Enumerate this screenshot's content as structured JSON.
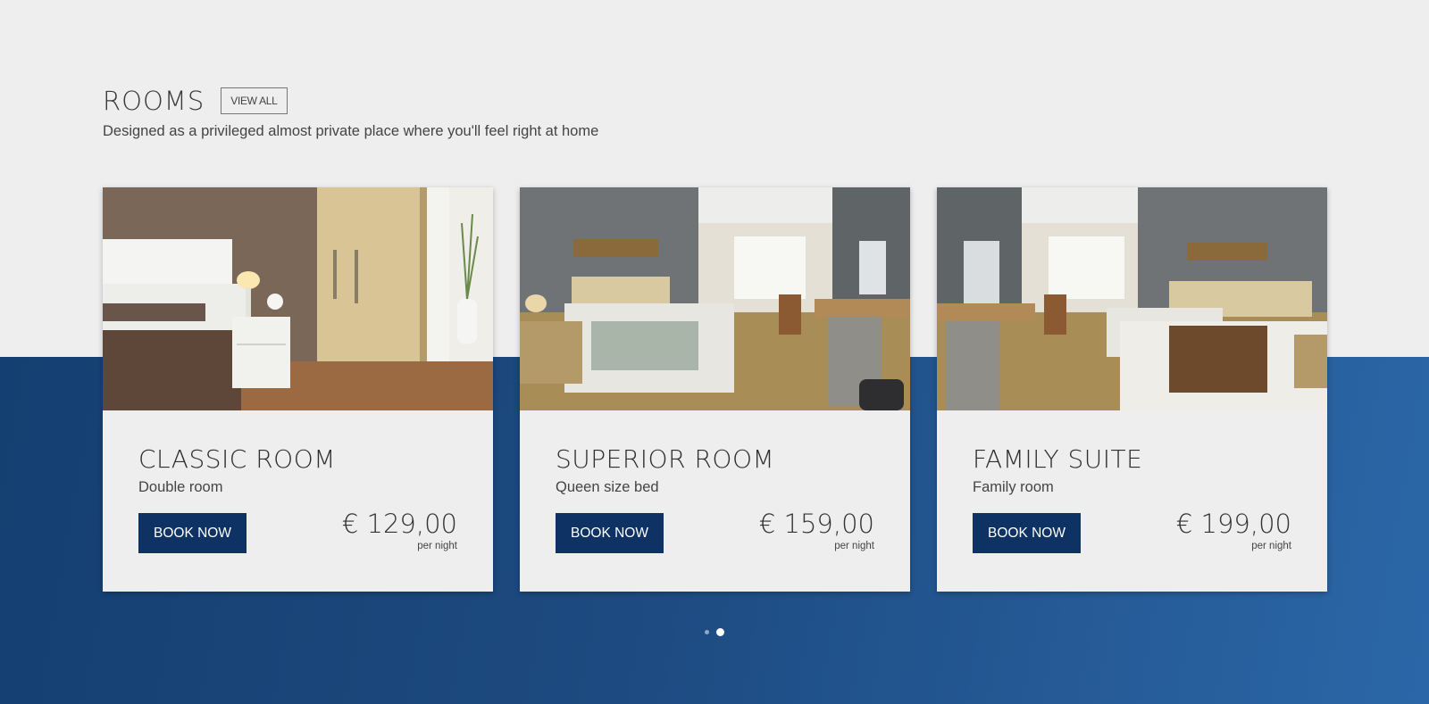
{
  "section": {
    "title": "ROOMS",
    "view_all_label": "VIEW ALL",
    "subtitle": "Designed as a privileged almost private place where you'll feel right at home"
  },
  "rooms": [
    {
      "name": "CLASSIC ROOM",
      "type": "Double room",
      "book_label": "BOOK NOW",
      "price": "€ 129,00",
      "per_night": "per night"
    },
    {
      "name": "SUPERIOR ROOM",
      "type": "Queen size bed",
      "book_label": "BOOK NOW",
      "price": "€ 159,00",
      "per_night": "per night"
    },
    {
      "name": "FAMILY SUITE",
      "type": "Family room",
      "book_label": "BOOK NOW",
      "price": "€ 199,00",
      "per_night": "per night"
    }
  ],
  "carousel": {
    "page_count": 2,
    "active_page": 2
  },
  "colors": {
    "background": "#eeeeee",
    "band": "#1d4a80",
    "button": "#0f3264"
  }
}
